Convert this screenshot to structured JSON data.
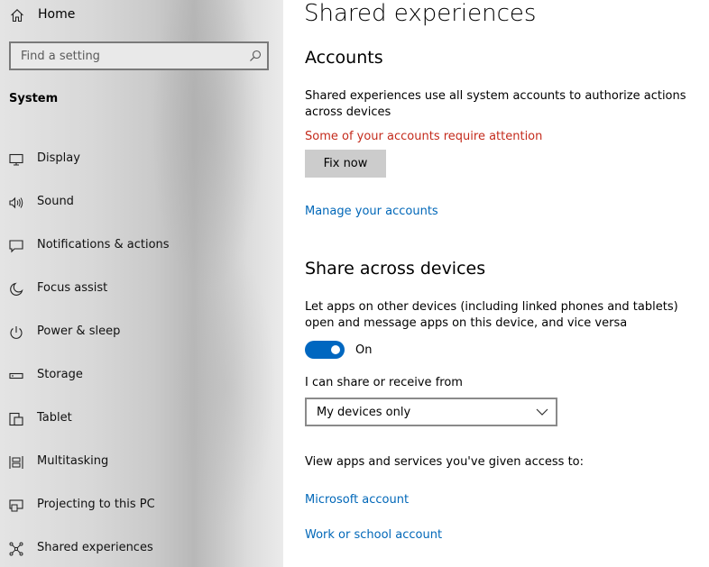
{
  "sidebar": {
    "home_label": "Home",
    "search_placeholder": "Find a setting",
    "section_title": "System",
    "items": [
      {
        "label": "Display",
        "icon": "display-icon"
      },
      {
        "label": "Sound",
        "icon": "sound-icon"
      },
      {
        "label": "Notifications & actions",
        "icon": "notifications-icon"
      },
      {
        "label": "Focus assist",
        "icon": "moon-icon"
      },
      {
        "label": "Power & sleep",
        "icon": "power-icon"
      },
      {
        "label": "Storage",
        "icon": "storage-icon"
      },
      {
        "label": "Tablet",
        "icon": "tablet-icon"
      },
      {
        "label": "Multitasking",
        "icon": "multitasking-icon"
      },
      {
        "label": "Projecting to this PC",
        "icon": "projecting-icon"
      },
      {
        "label": "Shared experiences",
        "icon": "shared-experiences-icon"
      }
    ]
  },
  "main": {
    "title": "Shared experiences",
    "accounts": {
      "heading": "Accounts",
      "description": "Shared experiences use all system accounts to authorize actions across devices",
      "warning": "Some of your accounts require attention",
      "fix_button": "Fix now",
      "manage_link": "Manage your accounts"
    },
    "share": {
      "heading": "Share across devices",
      "description": "Let apps on other devices (including linked phones and tablets) open and message apps on this device, and vice versa",
      "toggle_state": "On",
      "toggle_on": true,
      "share_label": "I can share or receive from",
      "dropdown_value": "My devices only",
      "access_text": "View apps and services you've given access to:",
      "links": [
        "Microsoft account",
        "Work or school account"
      ]
    }
  },
  "colors": {
    "accent": "#0067c0",
    "link": "#0067b8",
    "warning": "#c42b1c"
  }
}
